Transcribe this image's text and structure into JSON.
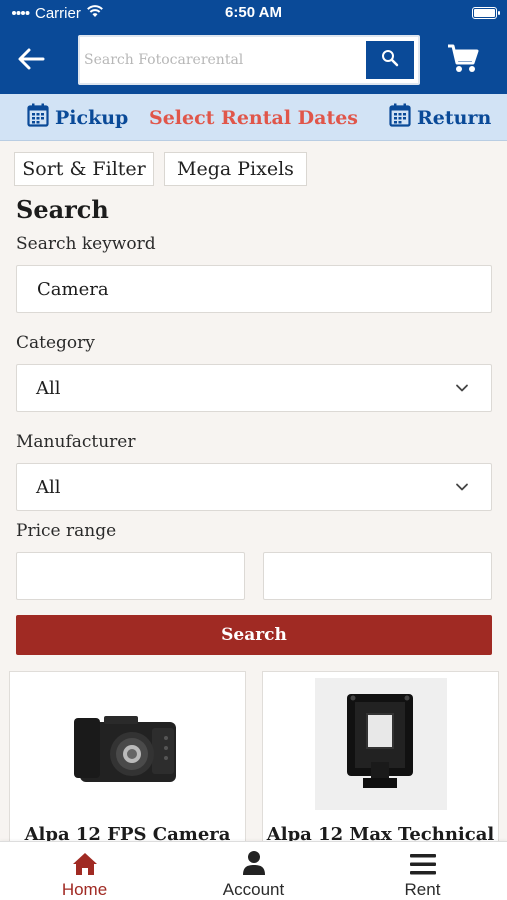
{
  "status_bar": {
    "carrier": "Carrier",
    "time": "6:50 AM",
    "battery_level": 1.0
  },
  "header": {
    "search_placeholder": "Search Fotocarerental"
  },
  "dates_bar": {
    "pickup_label": "Pickup",
    "select_label": "Select Rental Dates",
    "return_label": "Return"
  },
  "filters": {
    "sort_filter_label": "Sort & Filter",
    "mega_pixels_label": "Mega Pixels"
  },
  "search_form": {
    "title": "Search",
    "keyword_label": "Search keyword",
    "keyword_value": "Camera",
    "category_label": "Category",
    "category_value": "All",
    "manufacturer_label": "Manufacturer",
    "manufacturer_value": "All",
    "price_label": "Price range",
    "price_min": "",
    "price_max": "",
    "submit_label": "Search"
  },
  "products": [
    {
      "name": "Alpa 12 FPS Camera"
    },
    {
      "name": "Alpa 12 Max Technical"
    }
  ],
  "tabbar": {
    "home_label": "Home",
    "account_label": "Account",
    "rent_label": "Rent"
  },
  "colors": {
    "brand_blue": "#0a4a98",
    "accent_red": "#a02a23",
    "dates_highlight": "#e0564a",
    "dates_bar_bg": "#d2e3f5"
  },
  "icons": [
    "wifi-icon",
    "battery-icon",
    "back-arrow-icon",
    "search-icon",
    "cart-icon",
    "calendar-icon",
    "chevron-down-icon",
    "home-icon",
    "account-icon",
    "menu-icon"
  ]
}
